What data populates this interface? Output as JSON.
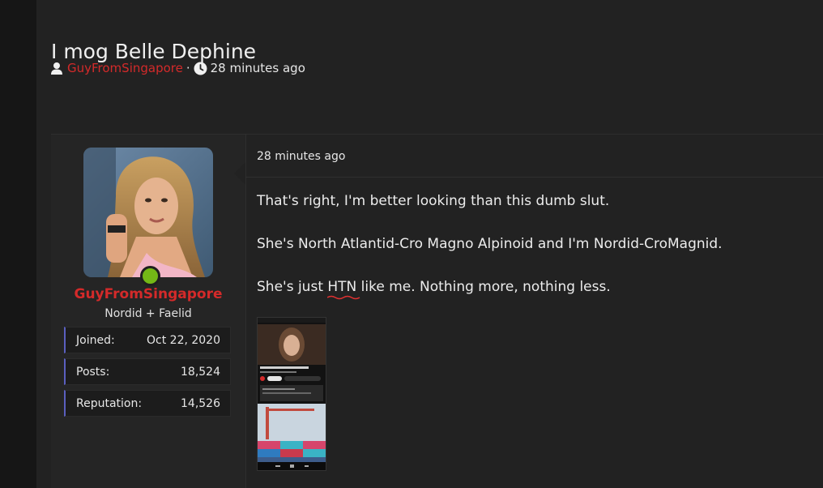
{
  "thread": {
    "title": "I mog Belle Dephine",
    "author": "GuyFromSingapore",
    "separator": "·",
    "time_ago": "28 minutes ago"
  },
  "user": {
    "name": "GuyFromSingapore",
    "title": "Nordid + Faelid",
    "stats": [
      {
        "label": "Joined:",
        "value": "Oct 22, 2020"
      },
      {
        "label": "Posts:",
        "value": "18,524"
      },
      {
        "label": "Reputation:",
        "value": "14,526"
      }
    ],
    "online_color": "#74b816"
  },
  "post": {
    "date": "28 minutes ago",
    "line1": "That's right, I'm better looking than this dumb slut.",
    "line2": "She's North Atlantid-Cro Magno Alpinoid and I'm Nordid-CroMagnid.",
    "line3_pre": "She's just ",
    "line3_mark": "HTN",
    "line3_post": " like me. Nothing more, nothing less."
  },
  "colors": {
    "accent_red": "#d42a2a",
    "stat_border": "#5a5fbf"
  },
  "icons": {
    "author": "user-icon",
    "time": "clock-icon"
  }
}
